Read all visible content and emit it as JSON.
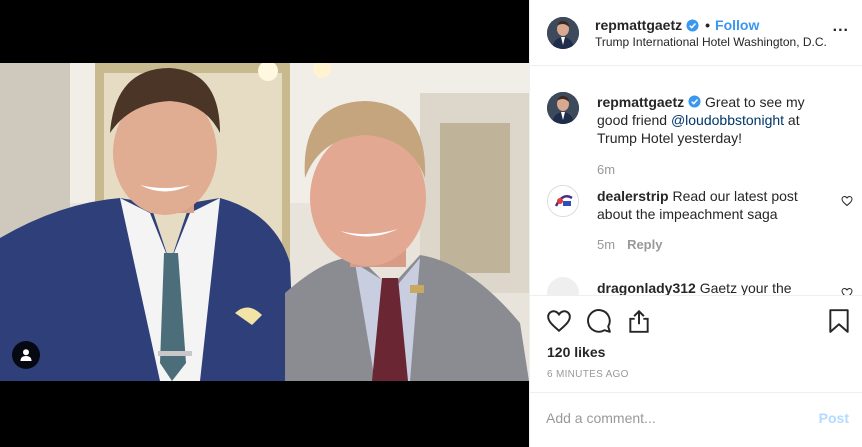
{
  "post": {
    "username": "repmattgaetz",
    "follow_label": "Follow",
    "location": "Trump International Hotel Washington, D.C.",
    "more_glyph": "...",
    "caption_rest_1": " Great to see my good friend ",
    "caption_mention": "@loudobbstonight",
    "caption_rest_2": " at Trump Hotel yesterday!",
    "caption_time": "6m",
    "likes": "120 likes",
    "posted": "6 MINUTES AGO"
  },
  "comments": [
    {
      "username": "dealerstrip",
      "text": " Read our latest post about the impeachment saga",
      "time": "5m",
      "reply_label": "Reply"
    },
    {
      "username": "dragonlady312",
      "text": " Gaetz your the"
    }
  ],
  "composer": {
    "placeholder": "Add a comment...",
    "post_label": "Post"
  },
  "icons": [
    "verified-badge-icon",
    "more-options-icon",
    "heart-icon",
    "comment-icon",
    "share-icon",
    "bookmark-icon",
    "user-tag-icon"
  ],
  "colors": {
    "link": "#3897f0",
    "post_disabled": "#b3dbff",
    "meta": "#999999",
    "mention": "#003569"
  }
}
